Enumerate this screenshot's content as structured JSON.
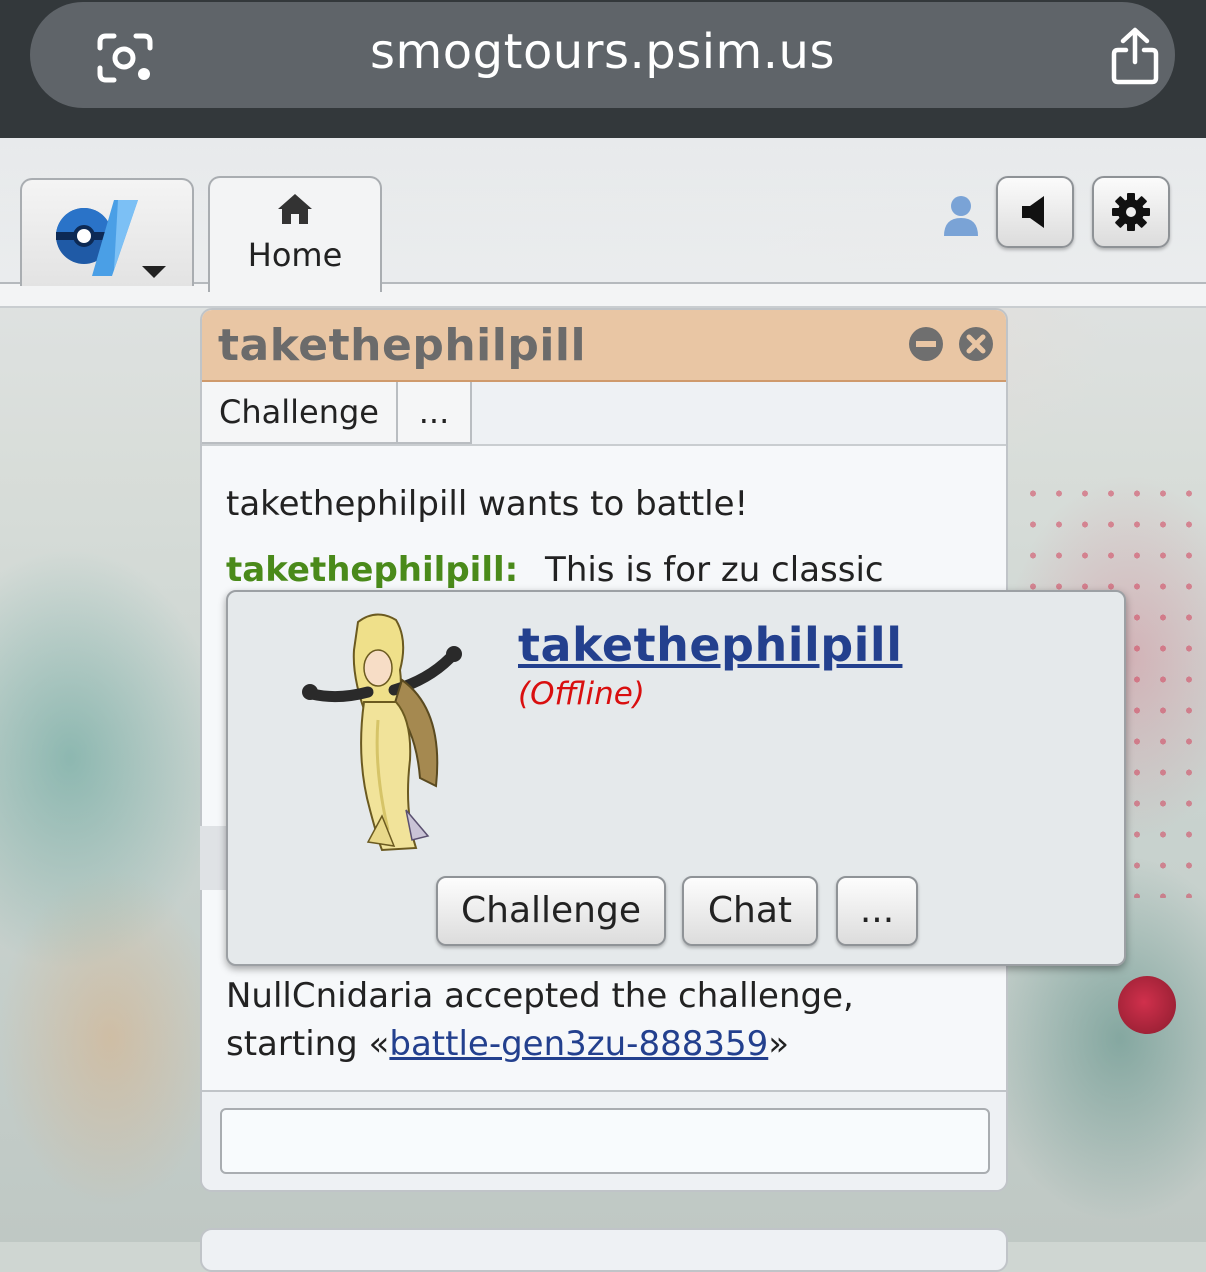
{
  "browser": {
    "url": "smogtours.psim.us",
    "lens_icon": "camera-search-icon",
    "share_icon": "share-icon"
  },
  "header": {
    "logo_icon": "pokemon-showdown-logo-icon",
    "home_tab": {
      "label": "Home",
      "icon": "home-icon"
    },
    "user_icon": "user-icon",
    "sound_icon": "sound-icon",
    "settings_icon": "gear-icon"
  },
  "pm": {
    "title": "takethephilpill",
    "tabs": [
      "Challenge",
      "..."
    ],
    "messages": {
      "wants_to_battle": "takethephilpill wants to battle!",
      "chat_user": "takethephilpill:",
      "chat_text": "This is for zu classic",
      "accepted_line1": "NullCnidaria accepted the challenge,",
      "accepted_line2_prefix": "starting «",
      "accepted_link": "battle-gen3zu-888359",
      "accepted_line2_suffix": "»"
    },
    "input_value": ""
  },
  "popup": {
    "username": "takethephilpill",
    "status": "(Offline)",
    "buttons": [
      "Challenge",
      "Chat",
      "..."
    ]
  }
}
